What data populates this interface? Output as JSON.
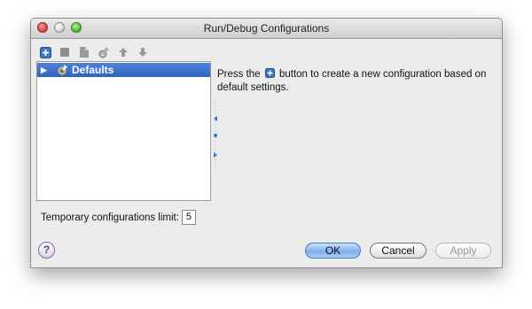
{
  "window": {
    "title": "Run/Debug Configurations"
  },
  "toolbar": {
    "icons": [
      "add-icon",
      "remove-icon",
      "copy-icon",
      "edit-defaults-icon",
      "move-up-icon",
      "move-down-icon"
    ]
  },
  "tree": {
    "items": [
      {
        "label": "Defaults",
        "expanded": false,
        "selected": true
      }
    ]
  },
  "info": {
    "text_before": "Press the",
    "text_after": "button to create a new configuration based on default settings."
  },
  "limit": {
    "label": "Temporary configurations limit:",
    "value": "5"
  },
  "buttons": {
    "ok": "OK",
    "cancel": "Cancel",
    "apply": "Apply"
  },
  "help": {
    "glyph": "?"
  },
  "colors": {
    "selection": "#3a6fcb",
    "ok_accent": "#7fb0ec"
  }
}
